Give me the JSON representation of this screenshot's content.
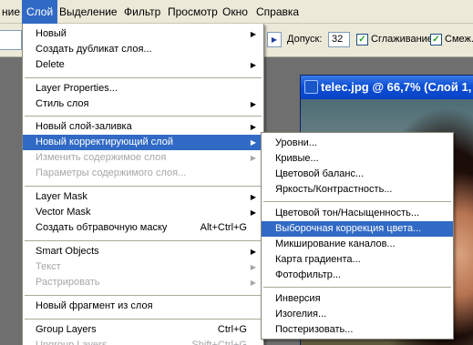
{
  "menubar": {
    "items": [
      {
        "label": "ние",
        "active": false
      },
      {
        "label": "Слой",
        "active": true
      },
      {
        "label": "Выделение",
        "active": false
      },
      {
        "label": "Фильтр",
        "active": false
      },
      {
        "label": "Просмотр",
        "active": false
      },
      {
        "label": "Окно",
        "active": false
      },
      {
        "label": "Справка",
        "active": false
      }
    ]
  },
  "options": {
    "tolerance_label": "Допуск:",
    "tolerance_value": "32",
    "antialias_label": "Сглаживание",
    "contiguous_label": "Смеж.п"
  },
  "document": {
    "title": "telec.jpg @ 66,7% (Слой 1,"
  },
  "layer_menu": {
    "items": [
      {
        "label": "Новый",
        "submenu": true
      },
      {
        "label": "Создать дубликат слоя..."
      },
      {
        "label": "Delete",
        "submenu": true
      },
      {
        "separator": true
      },
      {
        "label": "Layer Properties..."
      },
      {
        "label": "Стиль слоя",
        "submenu": true
      },
      {
        "separator": true
      },
      {
        "label": "Новый слой-заливка",
        "submenu": true
      },
      {
        "label": "Новый корректирующий слой",
        "submenu": true,
        "highlighted": true
      },
      {
        "label": "Изменить содержимое слоя",
        "submenu": true,
        "disabled": true
      },
      {
        "label": "Параметры содержимого слоя...",
        "disabled": true
      },
      {
        "separator": true
      },
      {
        "label": "Layer Mask",
        "submenu": true
      },
      {
        "label": "Vector Mask",
        "submenu": true
      },
      {
        "label": "Создать обтравочную маску",
        "shortcut": "Alt+Ctrl+G"
      },
      {
        "separator": true
      },
      {
        "label": "Smart Objects",
        "submenu": true
      },
      {
        "label": "Текст",
        "submenu": true,
        "disabled": true
      },
      {
        "label": "Растрировать",
        "submenu": true,
        "disabled": true
      },
      {
        "separator": true
      },
      {
        "label": "Новый фрагмент из слоя"
      },
      {
        "separator": true
      },
      {
        "label": "Group Layers",
        "shortcut": "Ctrl+G"
      },
      {
        "label": "Ungroup Layers",
        "shortcut": "Shift+Ctrl+G",
        "disabled": true
      }
    ]
  },
  "adjustment_submenu": {
    "items": [
      {
        "label": "Уровни..."
      },
      {
        "label": "Кривые..."
      },
      {
        "label": "Цветовой баланс..."
      },
      {
        "label": "Яркость/Контрастность..."
      },
      {
        "separator": true
      },
      {
        "label": "Цветовой тон/Насыщенность..."
      },
      {
        "label": "Выборочная коррекция цвета...",
        "highlighted": true
      },
      {
        "label": "Микширование каналов..."
      },
      {
        "label": "Карта градиента..."
      },
      {
        "label": "Фотофильтр..."
      },
      {
        "separator": true
      },
      {
        "label": "Инверсия"
      },
      {
        "label": "Изогелия..."
      },
      {
        "label": "Постеризовать..."
      }
    ]
  }
}
